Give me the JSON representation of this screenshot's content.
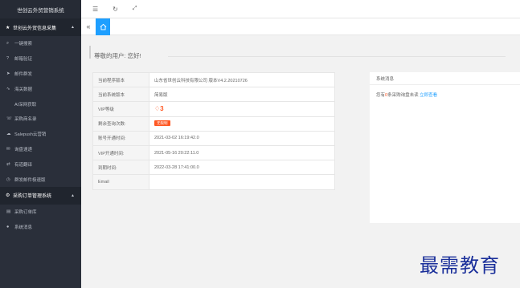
{
  "app": {
    "title": "世创云外贸营销系统"
  },
  "sidebar": {
    "group1": {
      "label": "世创云外贸信息采集",
      "icon": "star-icon"
    },
    "items1": [
      {
        "label": "一键搜索",
        "icon": "search-icon"
      },
      {
        "label": "邮箱验证",
        "icon": "question-icon"
      },
      {
        "label": "邮件群发",
        "icon": "send-icon"
      },
      {
        "label": "海关数据",
        "icon": "chart-icon"
      },
      {
        "label": "AI深网获取",
        "icon": "ai-icon"
      },
      {
        "label": "采购商名录",
        "icon": "phone-icon"
      },
      {
        "label": "Salepush云营销",
        "icon": "cloud-icon"
      },
      {
        "label": "询盘速递",
        "icon": "message-icon"
      },
      {
        "label": "有道翻译",
        "icon": "translate-icon"
      },
      {
        "label": "群发邮件极速版",
        "icon": "clock-icon"
      }
    ],
    "group2": {
      "label": "采购订单管理系统",
      "icon": "gear-icon"
    },
    "items2": [
      {
        "label": "采购订单库",
        "icon": "doc-icon"
      },
      {
        "label": "系统消息",
        "icon": "bell-icon"
      }
    ]
  },
  "tabs": {
    "home_icon": "home-icon"
  },
  "main": {
    "greeting": "尊敬的用户: 您好!",
    "info_rows": [
      {
        "key": "当前程序版本",
        "value": "山东省世创云科技有限公司 版本V4.2.20210726"
      },
      {
        "key": "当前系统版本",
        "value": "简易版"
      },
      {
        "key": "VIP等级",
        "value": "3"
      },
      {
        "key": "剩余查询次数:",
        "value": "无限制"
      },
      {
        "key": "账号开通时间:",
        "value": "2021-03-02 16:19:42.0"
      },
      {
        "key": "VIP开通时间:",
        "value": "2021-05-16 20:22:11.0"
      },
      {
        "key": "到期时间:",
        "value": "2022-03-28 17:41:00.0"
      },
      {
        "key": "Email",
        "value": ""
      }
    ],
    "sys_card": {
      "title": "系统消息",
      "text_pre": "您有",
      "count": "0",
      "text_mid": "条采购询盘未读",
      "link": "立即查看"
    }
  },
  "watermark": "最需教育"
}
